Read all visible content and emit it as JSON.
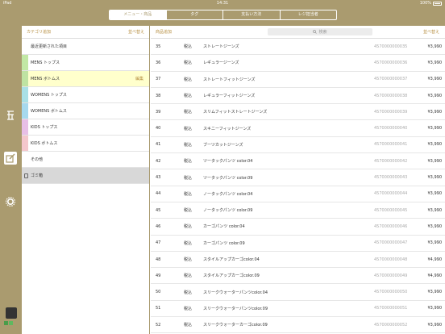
{
  "status": {
    "device": "iPad",
    "time": "14:31",
    "battery": "100%"
  },
  "tabs": [
    {
      "label": "メニュー・商品",
      "active": true
    },
    {
      "label": "タグ",
      "active": false
    },
    {
      "label": "支払い方法",
      "active": false
    },
    {
      "label": "レジ担当者",
      "active": false
    }
  ],
  "sidebar": {
    "icons": [
      "calculator-icon",
      "edit-icon",
      "gear-icon"
    ]
  },
  "categories_panel": {
    "add_label": "カテゴリ追加",
    "sort_label": "並べ替え",
    "items": [
      {
        "label": "最近更新された項目",
        "color": "#ffffff",
        "selected": false,
        "edit": ""
      },
      {
        "label": "MENS トップス",
        "color": "#c2e8a5",
        "selected": false,
        "edit": ""
      },
      {
        "label": "MENS ボトムス",
        "color": "#bfe3a2",
        "selected": true,
        "edit": "編集"
      },
      {
        "label": "WOMENS トップス",
        "color": "#a9e0e6",
        "selected": false,
        "edit": ""
      },
      {
        "label": "WOMENS ボトムス",
        "color": "#a6d9ee",
        "selected": false,
        "edit": ""
      },
      {
        "label": "KIDS トップス",
        "color": "#e8bfe6",
        "selected": false,
        "edit": ""
      },
      {
        "label": "KIDS ボトムス",
        "color": "#f4c7cc",
        "selected": false,
        "edit": ""
      },
      {
        "label": "その他",
        "color": "#ffffff",
        "selected": false,
        "edit": ""
      }
    ],
    "trash_label": "ゴミ箱"
  },
  "products_panel": {
    "add_label": "商品追加",
    "search_placeholder": "検索",
    "sort_label": "並べ替え",
    "rows": [
      {
        "num": "35",
        "tax": "税込",
        "name": "ストレートジーンズ",
        "code": "4570000000035",
        "price": "¥3,990"
      },
      {
        "num": "36",
        "tax": "税込",
        "name": "レギュラージーンズ",
        "code": "4570000000036",
        "price": "¥3,990"
      },
      {
        "num": "37",
        "tax": "税込",
        "name": "ストレートフィットジーンズ",
        "code": "4570000000037",
        "price": "¥3,990"
      },
      {
        "num": "38",
        "tax": "税込",
        "name": "レギュラーフィットジーンズ",
        "code": "4570000000038",
        "price": "¥3,990"
      },
      {
        "num": "39",
        "tax": "税込",
        "name": "スリムフィットストレートジーンズ",
        "code": "4570000000039",
        "price": "¥3,990"
      },
      {
        "num": "40",
        "tax": "税込",
        "name": "スキニーフィットジーンズ",
        "code": "4570000000040",
        "price": "¥3,990"
      },
      {
        "num": "41",
        "tax": "税込",
        "name": "ブーツカットジーンズ",
        "code": "4570000000041",
        "price": "¥3,990"
      },
      {
        "num": "42",
        "tax": "税込",
        "name": "ツータックパンツ color.04",
        "code": "4570000000042",
        "price": "¥3,990"
      },
      {
        "num": "43",
        "tax": "税込",
        "name": "ツータックパンツ color.09",
        "code": "4570000000043",
        "price": "¥3,990"
      },
      {
        "num": "44",
        "tax": "税込",
        "name": "ノータックパンツ color.04",
        "code": "4570000000044",
        "price": "¥3,990"
      },
      {
        "num": "45",
        "tax": "税込",
        "name": "ノータックパンツ color.09",
        "code": "4570000000045",
        "price": "¥3,990"
      },
      {
        "num": "46",
        "tax": "税込",
        "name": "カーゴパンツ color.04",
        "code": "4570000000046",
        "price": "¥3,990"
      },
      {
        "num": "47",
        "tax": "税込",
        "name": "カーゴパンツ color.09",
        "code": "4570000000047",
        "price": "¥3,990"
      },
      {
        "num": "48",
        "tax": "税込",
        "name": "スタイルアップカーゴcolor.04",
        "code": "4570000000048",
        "price": "¥4,990"
      },
      {
        "num": "49",
        "tax": "税込",
        "name": "スタイルアップカーゴcolor.09",
        "code": "4570000000049",
        "price": "¥4,990"
      },
      {
        "num": "50",
        "tax": "税込",
        "name": "スリークウォーターパンツcolor.04",
        "code": "4570000000050",
        "price": "¥3,990"
      },
      {
        "num": "51",
        "tax": "税込",
        "name": "スリークウォーターパンツcolor.09",
        "code": "4570000000051",
        "price": "¥3,990"
      },
      {
        "num": "52",
        "tax": "税込",
        "name": "スリークウォーターカーゴcolor.09",
        "code": "4570000000052",
        "price": "¥3,990"
      }
    ]
  },
  "colors": {
    "brand": "#aa9b6f",
    "accent": "#b68d3f"
  }
}
